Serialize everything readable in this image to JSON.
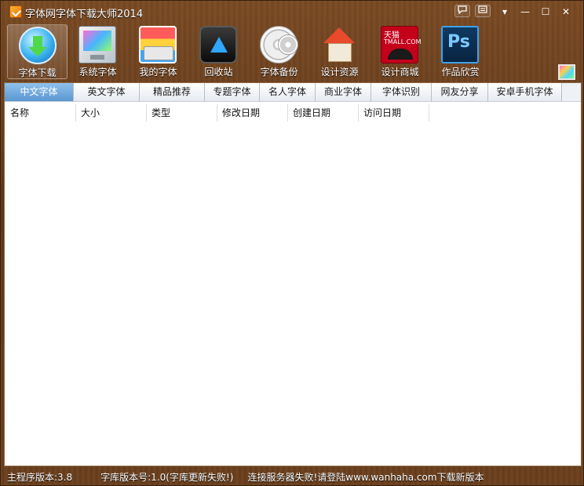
{
  "window": {
    "title": "字体网字体下载大师2014",
    "controls": {
      "feedback_icon": "chat-bubble-icon",
      "menu_icon": "menu-icon",
      "minimize": "▾",
      "restore": "—",
      "maximize": "☐",
      "close": "✕"
    }
  },
  "toolbar": {
    "items": [
      {
        "label": "字体下载",
        "icon": "download-icon",
        "active": true
      },
      {
        "label": "系统字体",
        "icon": "monitor-icon"
      },
      {
        "label": "我的字体",
        "icon": "my-fonts-icon"
      },
      {
        "label": "回收站",
        "icon": "recycle-bin-icon"
      },
      {
        "label": "字体备份",
        "icon": "disc-backup-icon"
      },
      {
        "label": "设计资源",
        "icon": "house-icon"
      },
      {
        "label": "设计商城",
        "icon": "tmall-icon"
      },
      {
        "label": "作品欣赏",
        "icon": "photoshop-icon"
      }
    ],
    "tmall_logo_top": "天猫",
    "tmall_logo_bottom": "TMALL.COM",
    "ps_logo": "Ps"
  },
  "tabs": [
    {
      "label": "中文字体",
      "active": true
    },
    {
      "label": "英文字体"
    },
    {
      "label": "精品推荐"
    },
    {
      "label": "专题字体"
    },
    {
      "label": "名人字体"
    },
    {
      "label": "商业字体"
    },
    {
      "label": "字体识别"
    },
    {
      "label": "网友分享"
    },
    {
      "label": "安卓手机字体"
    }
  ],
  "grid": {
    "columns": [
      "名称",
      "大小",
      "类型",
      "修改日期",
      "创建日期",
      "访问日期"
    ],
    "rows": []
  },
  "status": {
    "program_version": "主程序版本:3.8",
    "library_version": "字库版本号:1.0(字库更新失败!)",
    "connection": "连接服务器失败!请登陆www.wanhaha.com下载新版本"
  },
  "colors": {
    "wood_brown": "#6b3f1c",
    "active_tab": "#5b97d1",
    "status_text": "#ffffff"
  }
}
